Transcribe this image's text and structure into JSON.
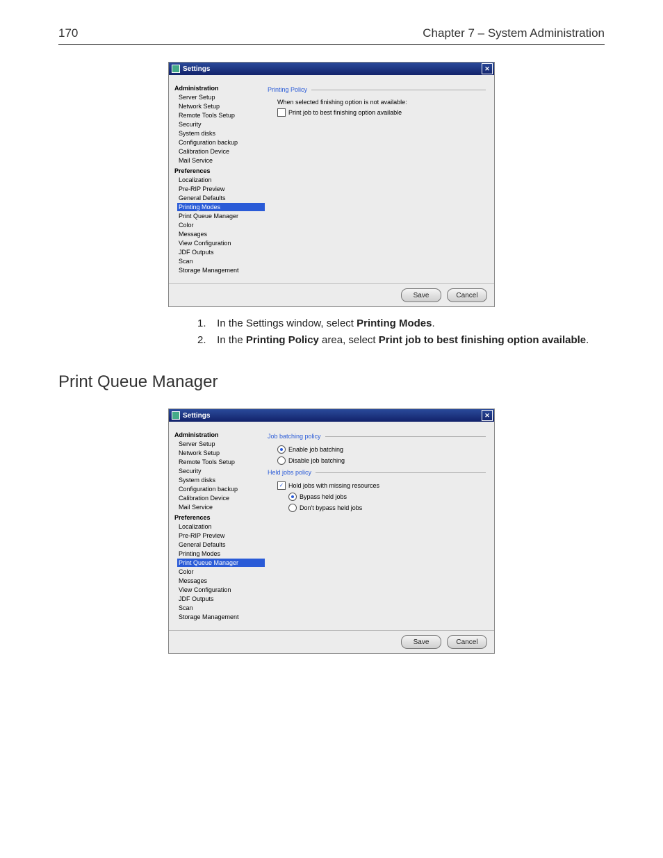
{
  "header": {
    "page_number": "170",
    "chapter": "Chapter 7 – System Administration"
  },
  "sidebar_groups": [
    {
      "title": "Administration",
      "items": [
        "Server Setup",
        "Network Setup",
        "Remote Tools Setup",
        "Security",
        "System disks",
        "Configuration backup",
        "Calibration Device",
        "Mail Service"
      ]
    },
    {
      "title": "Preferences",
      "items": [
        "Localization",
        "Pre-RIP Preview",
        "General Defaults",
        "Printing Modes",
        "Print Queue Manager",
        "Color",
        "Messages",
        "View Configuration",
        "JDF Outputs",
        "Scan",
        "Storage Management"
      ]
    }
  ],
  "dlg1": {
    "title": "Settings",
    "selected": "Printing Modes",
    "group": "Printing Policy",
    "desc": "When selected finishing option is not available:",
    "opt": "Print job to best finishing option available",
    "save": "Save",
    "cancel": "Cancel"
  },
  "dlg2": {
    "title": "Settings",
    "selected": "Print Queue Manager",
    "g1": "Job batching policy",
    "g1_enable": "Enable job batching",
    "g1_disable": "Disable job batching",
    "g2": "Held jobs policy",
    "g2_hold": "Hold jobs with missing resources",
    "g2_bypass": "Bypass held jobs",
    "g2_dont": "Don't bypass held jobs",
    "save": "Save",
    "cancel": "Cancel"
  },
  "instr": {
    "n1": "1.",
    "t1a": "In the Settings window, select ",
    "t1b": "Printing Modes",
    "t1c": ".",
    "n2": "2.",
    "t2a": "In the ",
    "t2b": "Printing Policy",
    "t2c": " area, select ",
    "t2d": "Print job to best finishing option available",
    "t2e": "."
  },
  "section2_title": "Print Queue Manager"
}
